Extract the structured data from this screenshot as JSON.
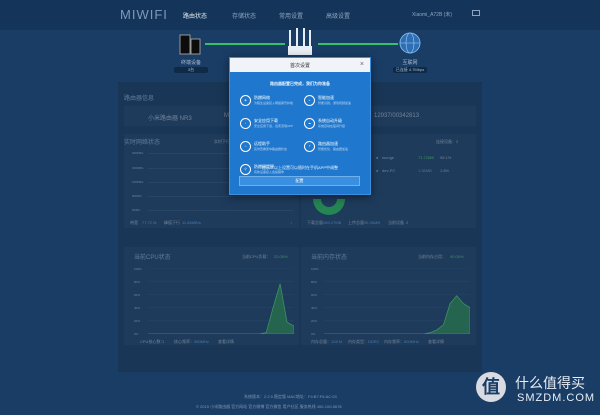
{
  "header": {
    "logo": "MIWIFI",
    "tabs": [
      {
        "label": "路由状态",
        "active": true
      },
      {
        "label": "存储状态",
        "active": false
      },
      {
        "label": "常用设置",
        "active": false
      },
      {
        "label": "高级设置",
        "active": false
      }
    ],
    "user": "Xiaomi_A72B (未)"
  },
  "topology": {
    "devices_caption": "终端设备",
    "devices_count": "3台",
    "internet_caption": "互联网",
    "internet_speed": "已连接 4.7Mbps"
  },
  "router_info": {
    "title": "路由器信息",
    "model": "小米路由器 NR3",
    "mac_partial": "M",
    "serial": "12937/00342813"
  },
  "network_status": {
    "title": "实时网络状态",
    "interval": "实时下行速度",
    "y_ticks": [
      "200KB/s",
      "150KB/s",
      "100KB/s",
      "50KB/s",
      "0KB/s"
    ],
    "down_label": "带宽",
    "down_value": "77.72 M",
    "peak_label": "峰值下行",
    "peak_value": "11.88MB/s",
    "peak_suffix": "↓"
  },
  "devices_traffic": {
    "connected": "连接设备：2",
    "rows": [
      {
        "name": "lounge",
        "speed": "71.72MB",
        "pct": "98.1%"
      },
      {
        "name": "dev-PC",
        "speed": "1.36MB",
        "pct": "1.8%"
      }
    ],
    "down_total_label": "下载总量",
    "down_total": "289.27MB",
    "up_total_label": "上传总量",
    "up_total": "35.36MB",
    "count_label": "当前设备",
    "count": "2"
  },
  "cpu": {
    "title": "当前CPU状态",
    "usage_label": "当前CPU负载：",
    "usage": "22.05%",
    "y_ticks": [
      "100%",
      "80%",
      "60%",
      "40%",
      "20%",
      "0%"
    ],
    "cores_label": "CPU核心数：",
    "cores": "1",
    "freq_label": "核心频率：",
    "freq": "580MHz",
    "more": "查看详情",
    "series": [
      0,
      0,
      0,
      0,
      0,
      0,
      0,
      0,
      0,
      0,
      0,
      0,
      0,
      0,
      0,
      0,
      0,
      2,
      40,
      76,
      18,
      12
    ]
  },
  "memory": {
    "title": "当前内存状态",
    "usage_label": "当前内存占用：",
    "usage": "40.00%",
    "y_ticks": [
      "100%",
      "80%",
      "60%",
      "40%",
      "20%",
      "0%"
    ],
    "total_label": "内存总量：",
    "total": "128 M",
    "type_label": "内存类型：",
    "type": "DDR2",
    "freq_label": "内存频率：",
    "freq": "800MHz",
    "more": "查看详情",
    "series": [
      0,
      0,
      0,
      0,
      0,
      0,
      0,
      0,
      0,
      0,
      0,
      0,
      0,
      0,
      0,
      0,
      2,
      6,
      14,
      46,
      58,
      46,
      40
    ]
  },
  "footer": {
    "line1": "系统版本：2.2.9 稳定版 MAC地址：F4:B7:F6:AC:03",
    "line2": "© 2015 小米路由器   官方网站   官方微博   官方微信   用户社区   服务热线 400-100-5678"
  },
  "modal": {
    "title": "首次设置",
    "close_icon": "close-icon",
    "subtitle": "路由器配置已完成，我们为你准备",
    "features": [
      {
        "icon": "firewall",
        "title": "防蹭网络",
        "desc": "为陌生设备接入网络保驾护航"
      },
      {
        "icon": "download",
        "title": "安全应用下载",
        "desc": "安全应用下载，远离流氓APP"
      },
      {
        "icon": "remote",
        "title": "远程助手",
        "desc": "实时查看家中路由器状态"
      },
      {
        "icon": "speed",
        "title": "智能加速",
        "desc": "智能识别，游戏视频加速"
      },
      {
        "icon": "link",
        "title": "防蹭网提醒",
        "desc": "有新设备接入会提醒你"
      },
      {
        "icon": "cloud",
        "title": "系统自动升级",
        "desc": "系统自动在夜间升级"
      },
      {
        "icon": "router",
        "title": "路由器加速",
        "desc": "智能优化，路由器加速"
      }
    ],
    "hint": "提示：以上设置可以随时在手机APP中调整",
    "button": "配置"
  },
  "watermark": {
    "badge": "值",
    "cn": "什么值得买",
    "en": "SMZDM.COM"
  }
}
